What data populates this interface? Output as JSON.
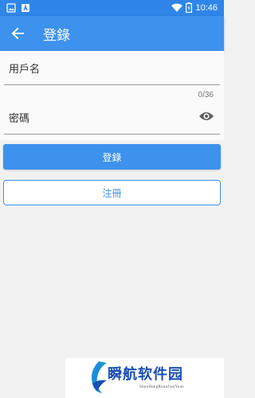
{
  "status_bar": {
    "time": "10:46",
    "icons": [
      "image-icon",
      "a-notification-icon",
      "wifi-icon",
      "battery-icon"
    ]
  },
  "app_bar": {
    "title": "登錄",
    "back_icon": "arrow-left-icon",
    "color": "#3d92ee"
  },
  "form": {
    "username": {
      "placeholder": "用戶名",
      "value": ""
    },
    "username_counter": "0/36",
    "password": {
      "placeholder": "密碼",
      "value": ""
    },
    "visibility_icon": "eye-icon"
  },
  "actions": {
    "login_label": "登錄",
    "register_label": "注冊"
  },
  "watermark": {
    "title": "瞬航软件园",
    "subtitle": "ShunHangRuanJianYuan"
  },
  "colors": {
    "primary": "#3d92ee",
    "status_bar": "#2f86e8",
    "background": "#f2f2f2"
  }
}
